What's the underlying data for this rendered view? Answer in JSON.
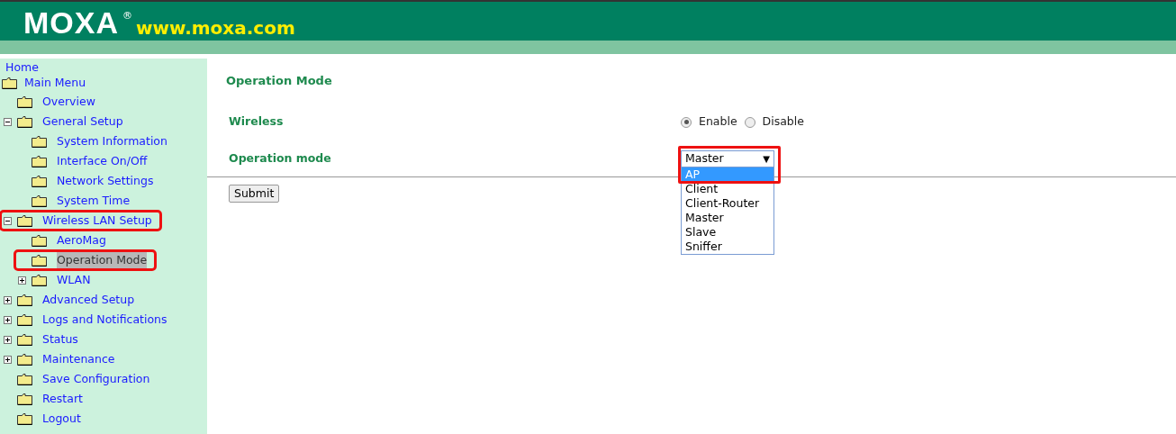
{
  "header": {
    "logo": "MOXA",
    "registered": "®",
    "url": "www.moxa.com"
  },
  "sidebar": {
    "home": "Home",
    "tree": {
      "label": "Main Menu",
      "children": [
        {
          "label": "Overview",
          "selected": false,
          "highlighted": false
        },
        {
          "label": "General Setup",
          "expanded": true,
          "selected": false,
          "highlighted": false,
          "children": [
            {
              "label": "System Information",
              "selected": false,
              "highlighted": false
            },
            {
              "label": "Interface On/Off",
              "selected": false,
              "highlighted": false
            },
            {
              "label": "Network Settings",
              "selected": false,
              "highlighted": false
            },
            {
              "label": "System Time",
              "selected": false,
              "highlighted": false
            }
          ]
        },
        {
          "label": "Wireless LAN Setup",
          "expanded": true,
          "selected": false,
          "highlighted": true,
          "children": [
            {
              "label": "AeroMag",
              "selected": false,
              "highlighted": false
            },
            {
              "label": "Operation Mode",
              "selected": true,
              "highlighted": true
            },
            {
              "label": "WLAN",
              "expanded": false,
              "selected": false,
              "highlighted": false
            }
          ]
        },
        {
          "label": "Advanced Setup",
          "expanded": false,
          "selected": false,
          "highlighted": false
        },
        {
          "label": "Logs and Notifications",
          "expanded": false,
          "selected": false,
          "highlighted": false
        },
        {
          "label": "Status",
          "expanded": false,
          "selected": false,
          "highlighted": false
        },
        {
          "label": "Maintenance",
          "expanded": false,
          "selected": false,
          "highlighted": false
        },
        {
          "label": "Save Configuration",
          "selected": false,
          "highlighted": false
        },
        {
          "label": "Restart",
          "selected": false,
          "highlighted": false
        },
        {
          "label": "Logout",
          "selected": false,
          "highlighted": false
        }
      ]
    }
  },
  "main": {
    "title": "Operation Mode",
    "wireless": {
      "label": "Wireless",
      "options": [
        {
          "label": "Enable",
          "selected": true
        },
        {
          "label": "Disable",
          "selected": false
        }
      ]
    },
    "operation_mode": {
      "label": "Operation mode",
      "value": "Master",
      "caret": "▼",
      "highlighted": true,
      "expanded": true,
      "options": [
        {
          "label": "AP",
          "highlighted": true
        },
        {
          "label": "Client",
          "highlighted": false
        },
        {
          "label": "Client-Router",
          "highlighted": false
        },
        {
          "label": "Master",
          "highlighted": false
        },
        {
          "label": "Slave",
          "highlighted": false
        },
        {
          "label": "Sniffer",
          "highlighted": false
        }
      ]
    },
    "submit": "Submit"
  }
}
